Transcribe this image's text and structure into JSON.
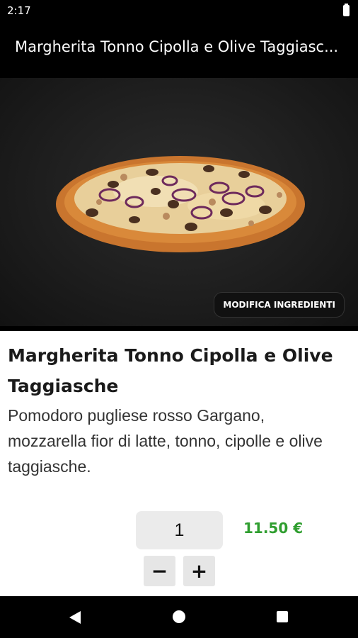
{
  "status_bar": {
    "time": "2:17",
    "battery_icon": "battery-icon"
  },
  "app_bar": {
    "title": "Margherita Tonno Cipolla e Olive Taggiasc..."
  },
  "hero": {
    "image": "pizza-photo",
    "edit_button_label": "MODIFICA INGREDIENTI"
  },
  "product": {
    "name": "Margherita Tonno Cipolla e Olive Taggiasche",
    "description": "Pomodoro pugliese rosso Gargano, mozzarella fior di latte, tonno, cipolle e olive taggiasche."
  },
  "order": {
    "quantity": "1",
    "price": "11.50 €",
    "decrement_label": "−",
    "increment_label": "+",
    "price_color": "#2f9e2f"
  },
  "nav_bar": {
    "icons": [
      "back-icon",
      "home-icon",
      "recents-icon"
    ]
  }
}
